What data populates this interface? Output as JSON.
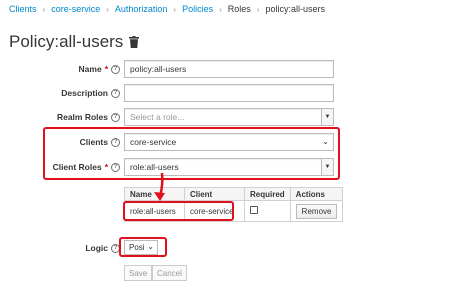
{
  "breadcrumb": [
    "Clients",
    "core-service",
    "Authorization",
    "Policies",
    "Roles",
    "policy:all-users"
  ],
  "page": {
    "title": "Policy:all-users"
  },
  "form": {
    "name": {
      "label": "Name",
      "value": "policy:all-users"
    },
    "description": {
      "label": "Description",
      "value": ""
    },
    "realm_roles": {
      "label": "Realm Roles",
      "placeholder": "Select a role..."
    },
    "clients": {
      "label": "Clients",
      "value": "core-service"
    },
    "client_roles": {
      "label": "Client Roles",
      "value": "role:all-users"
    },
    "logic": {
      "label": "Logic",
      "value": "Posi"
    }
  },
  "table": {
    "headers": [
      "Name",
      "Client",
      "Required",
      "Actions"
    ],
    "rows": [
      {
        "name": "role:all-users",
        "client": "core-service",
        "required": false,
        "action": "Remove"
      }
    ]
  },
  "buttons": {
    "save": "Save",
    "cancel": "Cancel"
  },
  "required_mark": "*",
  "help_glyph": "?",
  "colors": {
    "link": "#0088ce",
    "annotation": "#e0101e",
    "required": "#cc0000"
  }
}
